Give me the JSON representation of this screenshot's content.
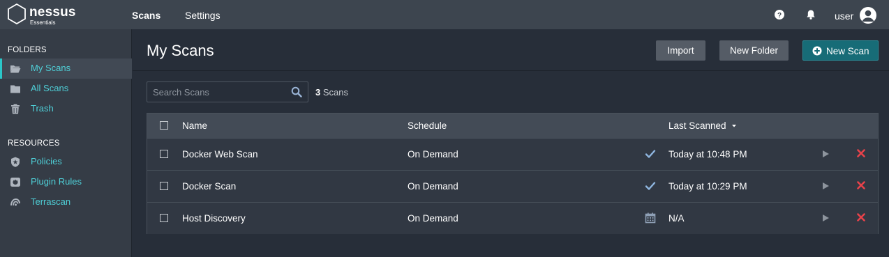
{
  "app": {
    "brand": "nessus",
    "edition": "Essentials"
  },
  "topnav": {
    "items": [
      {
        "label": "Scans"
      },
      {
        "label": "Settings"
      }
    ],
    "user": "user"
  },
  "sidebar": {
    "folders_title": "FOLDERS",
    "folders": [
      {
        "label": "My Scans",
        "icon": "folder-open-icon"
      },
      {
        "label": "All Scans",
        "icon": "folder-icon"
      },
      {
        "label": "Trash",
        "icon": "trash-icon"
      }
    ],
    "resources_title": "RESOURCES",
    "resources": [
      {
        "label": "Policies",
        "icon": "policy-shield-icon"
      },
      {
        "label": "Plugin Rules",
        "icon": "plugin-rules-icon"
      },
      {
        "label": "Terrascan",
        "icon": "terrascan-icon"
      }
    ]
  },
  "main": {
    "title": "My Scans",
    "buttons": {
      "import": "Import",
      "new_folder": "New Folder",
      "new_scan": "New Scan"
    },
    "search": {
      "placeholder": "Search Scans",
      "value": ""
    },
    "count": {
      "number": "3",
      "label": "Scans"
    }
  },
  "table": {
    "columns": {
      "name": "Name",
      "schedule": "Schedule",
      "last_scanned": "Last Scanned"
    },
    "rows": [
      {
        "name": "Docker Web Scan",
        "schedule": "On Demand",
        "status_icon": "check-icon",
        "last_scanned": "Today at 10:48 PM"
      },
      {
        "name": "Docker Scan",
        "schedule": "On Demand",
        "status_icon": "check-icon",
        "last_scanned": "Today at 10:29 PM"
      },
      {
        "name": "Host Discovery",
        "schedule": "On Demand",
        "status_icon": "calendar-icon",
        "last_scanned": "N/A"
      }
    ]
  },
  "colors": {
    "accent": "#2bc7c9",
    "link": "#4fd0d8",
    "primary_button": "#176c77",
    "delete": "#e8424a",
    "check": "#8fb6e0"
  }
}
